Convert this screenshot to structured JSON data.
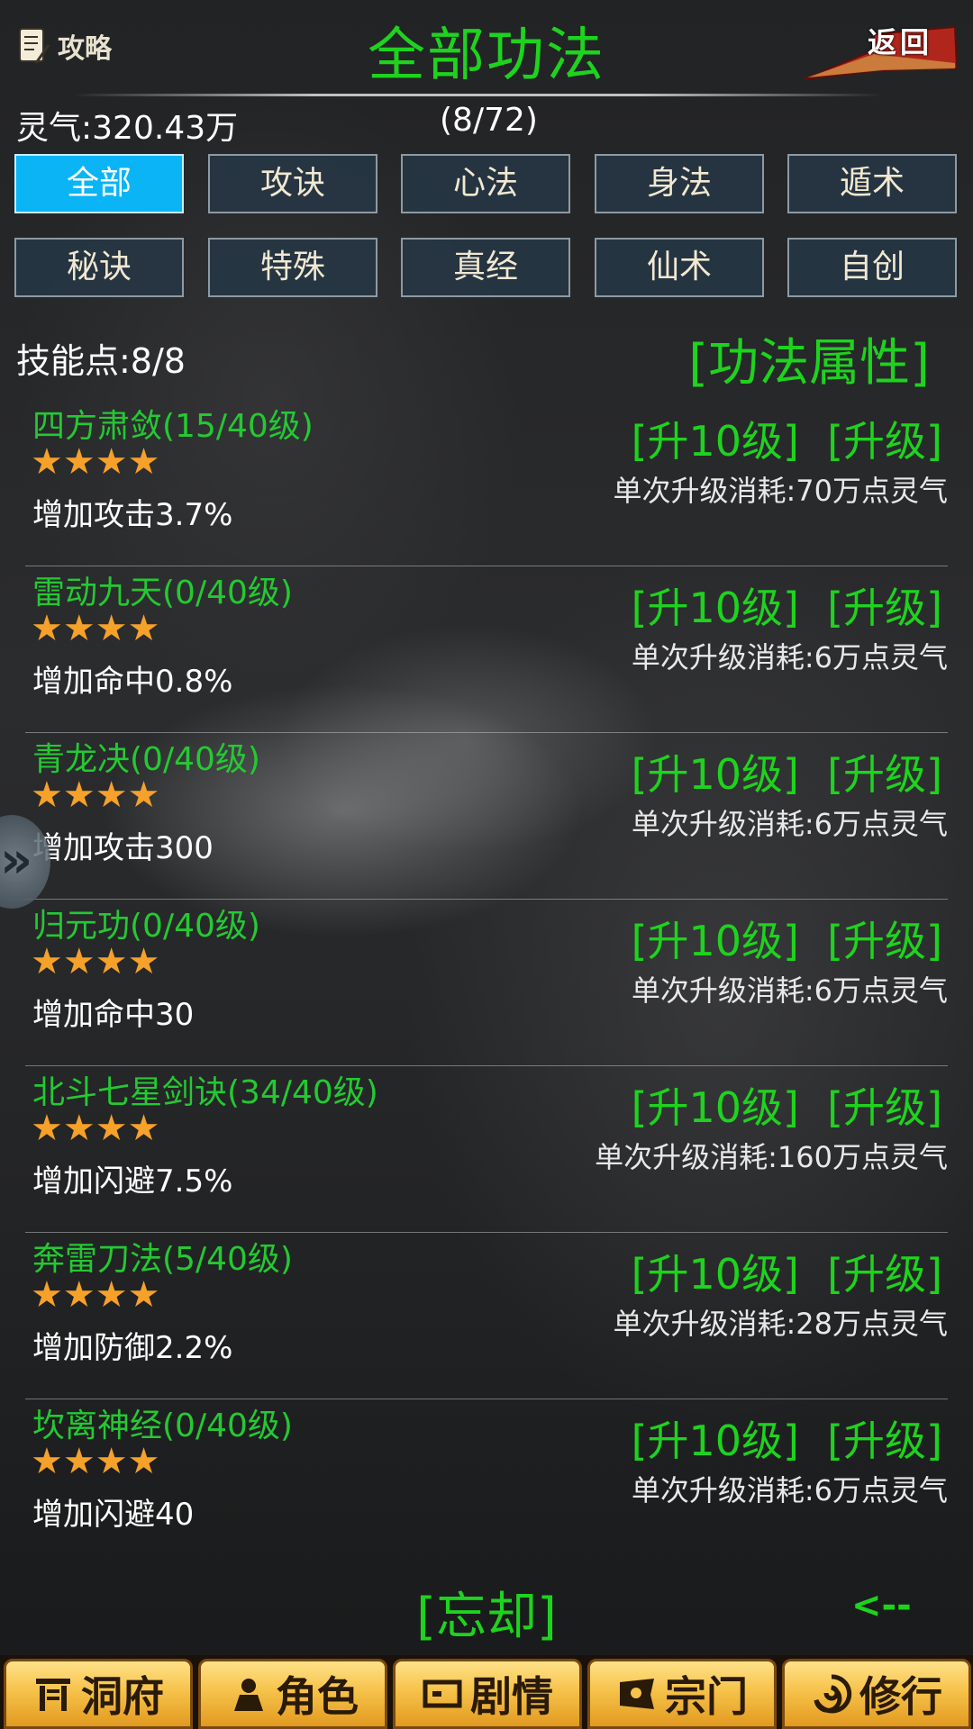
{
  "header": {
    "guide_label": "攻略",
    "title": "全部功法",
    "back_label": "返回"
  },
  "status": {
    "qi": "灵气:320.43万",
    "count": "(8/72)"
  },
  "tabs": [
    {
      "label": "全部",
      "active": true
    },
    {
      "label": "攻诀",
      "active": false
    },
    {
      "label": "心法",
      "active": false
    },
    {
      "label": "身法",
      "active": false
    },
    {
      "label": "遁术",
      "active": false
    },
    {
      "label": "秘诀",
      "active": false
    },
    {
      "label": "特殊",
      "active": false
    },
    {
      "label": "真经",
      "active": false
    },
    {
      "label": "仙术",
      "active": false
    },
    {
      "label": "自创",
      "active": false
    }
  ],
  "skill_points": "技能点:8/8",
  "attributes_link": "[功法属性]",
  "skills": [
    {
      "name": "四方肃敛(15/40级)",
      "stars": "★★★★",
      "effect": "增加攻击3.7%",
      "up10": "[升10级]",
      "up": "[升级]",
      "cost": "单次升级消耗:70万点灵气"
    },
    {
      "name": "雷动九天(0/40级)",
      "stars": "★★★★",
      "effect": "增加命中0.8%",
      "up10": "[升10级]",
      "up": "[升级]",
      "cost": "单次升级消耗:6万点灵气"
    },
    {
      "name": "青龙决(0/40级)",
      "stars": "★★★★",
      "effect": "增加攻击300",
      "up10": "[升10级]",
      "up": "[升级]",
      "cost": "单次升级消耗:6万点灵气"
    },
    {
      "name": "归元功(0/40级)",
      "stars": "★★★★",
      "effect": "增加命中30",
      "up10": "[升10级]",
      "up": "[升级]",
      "cost": "单次升级消耗:6万点灵气"
    },
    {
      "name": "北斗七星剑诀(34/40级)",
      "stars": "★★★★",
      "effect": "增加闪避7.5%",
      "up10": "[升10级]",
      "up": "[升级]",
      "cost": "单次升级消耗:160万点灵气"
    },
    {
      "name": "奔雷刀法(5/40级)",
      "stars": "★★★★",
      "effect": "增加防御2.2%",
      "up10": "[升10级]",
      "up": "[升级]",
      "cost": "单次升级消耗:28万点灵气"
    },
    {
      "name": "坎离神经(0/40级)",
      "stars": "★★★★",
      "effect": "增加闪避40",
      "up10": "[升10级]",
      "up": "[升级]",
      "cost": "单次升级消耗:6万点灵气"
    }
  ],
  "forget_label": "[忘却]",
  "prev_label": "<--",
  "nav": [
    {
      "label": "洞府",
      "icon": "cave-gate-icon"
    },
    {
      "label": "角色",
      "icon": "character-icon"
    },
    {
      "label": "剧情",
      "icon": "story-icon"
    },
    {
      "label": "宗门",
      "icon": "sect-flag-icon"
    },
    {
      "label": "修行",
      "icon": "cultivation-swirl-icon"
    }
  ],
  "colors": {
    "accent_green": "#1ed31e",
    "active_tab": "#0ab4f5",
    "star": "#f5a12a",
    "nav_gold": "#f6c24a"
  }
}
